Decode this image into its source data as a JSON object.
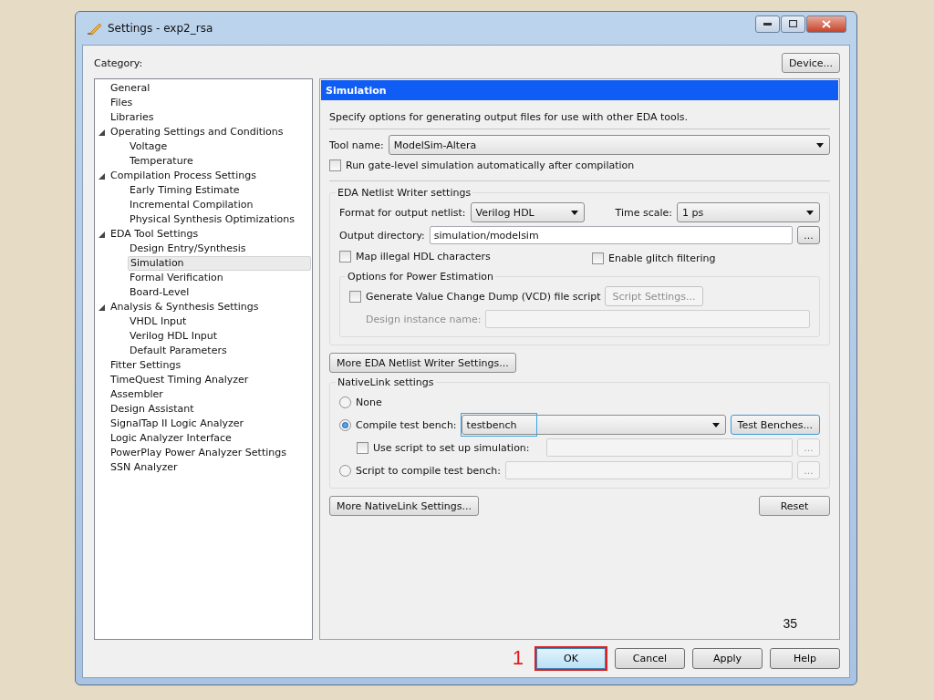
{
  "window": {
    "title": "Settings - exp2_rsa"
  },
  "category_label": "Category:",
  "device_button": "Device...",
  "tree": [
    {
      "label": "General",
      "selected": false
    },
    {
      "label": "Files",
      "selected": false
    },
    {
      "label": "Libraries",
      "selected": false
    },
    {
      "label": "Operating Settings and Conditions",
      "selected": false,
      "expanded": true,
      "children": [
        {
          "label": "Voltage",
          "selected": false
        },
        {
          "label": "Temperature",
          "selected": false
        }
      ]
    },
    {
      "label": "Compilation Process Settings",
      "selected": false,
      "expanded": true,
      "children": [
        {
          "label": "Early Timing Estimate",
          "selected": false
        },
        {
          "label": "Incremental Compilation",
          "selected": false
        },
        {
          "label": "Physical Synthesis Optimizations",
          "selected": false
        }
      ]
    },
    {
      "label": "EDA Tool Settings",
      "selected": false,
      "expanded": true,
      "children": [
        {
          "label": "Design Entry/Synthesis",
          "selected": false
        },
        {
          "label": "Simulation",
          "selected": true
        },
        {
          "label": "Formal Verification",
          "selected": false
        },
        {
          "label": "Board-Level",
          "selected": false
        }
      ]
    },
    {
      "label": "Analysis & Synthesis Settings",
      "selected": false,
      "expanded": true,
      "children": [
        {
          "label": "VHDL Input",
          "selected": false
        },
        {
          "label": "Verilog HDL Input",
          "selected": false
        },
        {
          "label": "Default Parameters",
          "selected": false
        }
      ]
    },
    {
      "label": "Fitter Settings",
      "selected": false
    },
    {
      "label": "TimeQuest Timing Analyzer",
      "selected": false
    },
    {
      "label": "Assembler",
      "selected": false
    },
    {
      "label": "Design Assistant",
      "selected": false
    },
    {
      "label": "SignalTap II Logic Analyzer",
      "selected": false
    },
    {
      "label": "Logic Analyzer Interface",
      "selected": false
    },
    {
      "label": "PowerPlay Power Analyzer Settings",
      "selected": false
    },
    {
      "label": "SSN Analyzer",
      "selected": false
    }
  ],
  "panel": {
    "title": "Simulation",
    "description": "Specify options for generating output files for use with other EDA tools.",
    "tool_name": {
      "label": "Tool name:",
      "value": "ModelSim-Altera"
    },
    "run_gate_level": {
      "label": "Run gate-level simulation automatically after compilation",
      "checked": false
    },
    "netlist": {
      "title": "EDA Netlist Writer settings",
      "format": {
        "label": "Format for output netlist:",
        "value": "Verilog HDL"
      },
      "time_scale": {
        "label": "Time scale:",
        "value": "1 ps"
      },
      "output_directory": {
        "label": "Output directory:",
        "value": "simulation/modelsim",
        "browse": "..."
      },
      "map_illegal": {
        "label": "Map illegal HDL characters",
        "checked": false
      },
      "glitch": {
        "label": "Enable glitch filtering",
        "checked": false
      },
      "power": {
        "title": "Options for Power Estimation",
        "vcd": {
          "label": "Generate Value Change Dump (VCD) file script",
          "checked": false
        },
        "script_settings": {
          "label": "Script Settings...",
          "disabled": true
        },
        "instance_name": {
          "label": "Design instance name:",
          "disabled": true
        }
      }
    },
    "more_netlist_button": "More EDA Netlist Writer Settings...",
    "nativelink": {
      "title": "NativeLink settings",
      "options": [
        {
          "label": "None",
          "selected": false
        },
        {
          "label": "Compile test bench:",
          "selected": true
        },
        {
          "label": "Script to compile test bench:",
          "selected": false
        }
      ],
      "test_bench": {
        "value": "testbench",
        "focused": true
      },
      "test_benches_button": "Test Benches...",
      "use_script": {
        "label": "Use script to set up simulation:",
        "checked": false,
        "browse": "..."
      },
      "script_browse": "..."
    },
    "more_nativelink_button": "More NativeLink Settings...",
    "reset_button": "Reset"
  },
  "slide_number": "35",
  "annotation": "1",
  "buttons": [
    {
      "label": "OK",
      "highlighted": true
    },
    {
      "label": "Cancel",
      "highlighted": false
    },
    {
      "label": "Apply",
      "highlighted": false
    },
    {
      "label": "Help",
      "highlighted": false
    }
  ]
}
